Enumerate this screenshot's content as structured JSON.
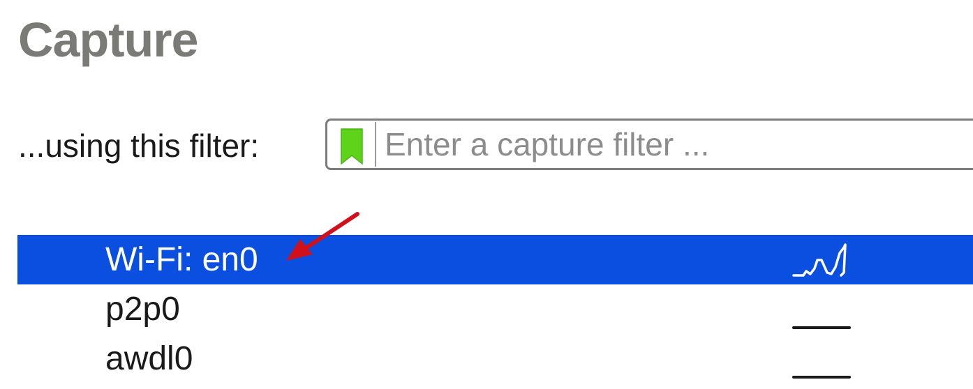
{
  "section": {
    "title": "Capture"
  },
  "filter": {
    "label": "...using this filter:",
    "placeholder": "Enter a capture filter ...",
    "value": "",
    "bookmark_color": "#5fd31a"
  },
  "interfaces": [
    {
      "name": "Wi-Fi: en0",
      "selected": true,
      "activity": "active"
    },
    {
      "name": "p2p0",
      "selected": false,
      "activity": "none"
    },
    {
      "name": "awdl0",
      "selected": false,
      "activity": "none"
    }
  ],
  "colors": {
    "selection": "#0a4fe0",
    "annotation_arrow": "#d0101a",
    "title_gray": "#7a7b76"
  }
}
